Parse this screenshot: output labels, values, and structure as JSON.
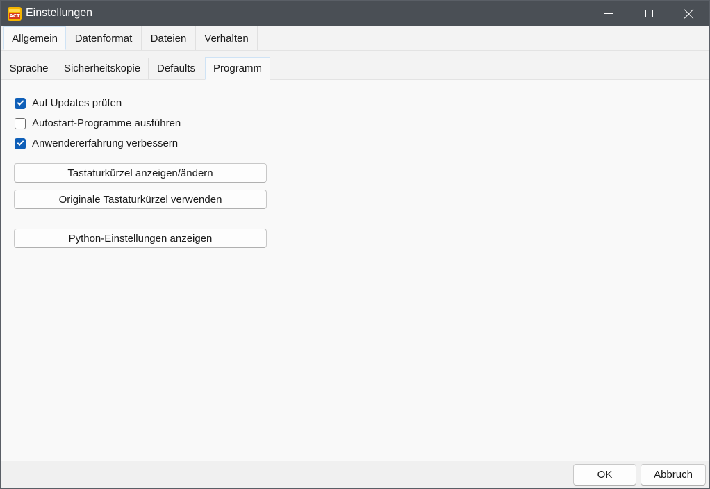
{
  "window": {
    "title": "Einstellungen",
    "app_icon": "app-logo-icon",
    "app_icon_text": "ACT"
  },
  "title_controls": {
    "minimize": "minimize-icon",
    "maximize": "maximize-icon",
    "close": "close-icon"
  },
  "main_tabs": [
    {
      "label": "Allgemein",
      "active": true
    },
    {
      "label": "Datenformat",
      "active": false
    },
    {
      "label": "Dateien",
      "active": false
    },
    {
      "label": "Verhalten",
      "active": false
    }
  ],
  "sub_tabs": [
    {
      "label": "Sprache",
      "active": false
    },
    {
      "label": "Sicherheitskopie",
      "active": false
    },
    {
      "label": "Defaults",
      "active": false
    },
    {
      "label": "Programm",
      "active": true
    }
  ],
  "options": [
    {
      "label": "Auf Updates prüfen",
      "checked": true
    },
    {
      "label": "Autostart-Programme ausführen",
      "checked": false
    },
    {
      "label": "Anwendererfahrung verbessern",
      "checked": true
    }
  ],
  "buttons": {
    "shortcuts_show": "Tastaturkürzel anzeigen/ändern",
    "shortcuts_reset": "Originale Tastaturkürzel verwenden",
    "python_settings": "Python-Einstellungen anzeigen"
  },
  "footer": {
    "ok": "OK",
    "cancel": "Abbruch"
  },
  "colors": {
    "titlebar": "#4a4f55",
    "accent": "#0f5fb8",
    "background": "#f9f9f9"
  }
}
